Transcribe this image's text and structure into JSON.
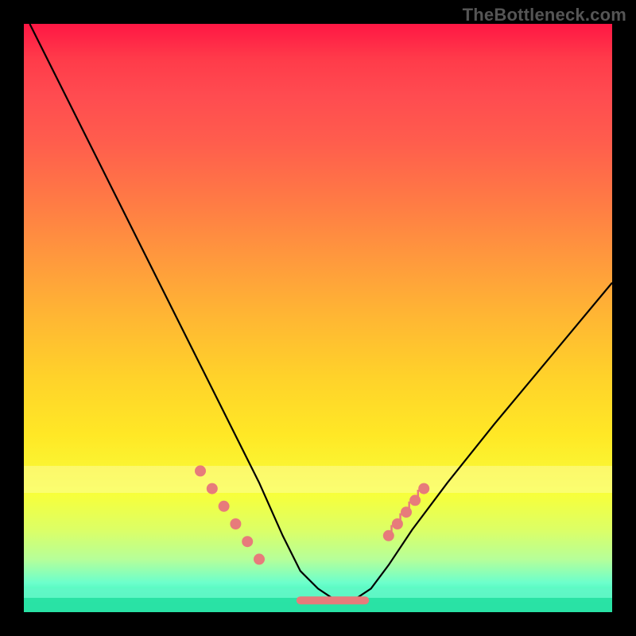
{
  "watermark": "TheBottleneck.com",
  "chart_data": {
    "type": "line",
    "title": "",
    "xlabel": "",
    "ylabel": "",
    "xlim": [
      0,
      100
    ],
    "ylim": [
      0,
      100
    ],
    "grid": false,
    "legend": false,
    "series": [
      {
        "name": "bottleneck-curve",
        "x": [
          1,
          5,
          10,
          15,
          20,
          25,
          30,
          35,
          40,
          44,
          47,
          50,
          53,
          56,
          59,
          62,
          66,
          72,
          80,
          90,
          100
        ],
        "y": [
          100,
          92,
          82,
          72,
          62,
          52,
          42,
          32,
          22,
          13,
          7,
          4,
          2,
          2,
          4,
          8,
          14,
          22,
          32,
          44,
          56
        ]
      }
    ],
    "markers": {
      "left_cluster_x": [
        30,
        32,
        34,
        36,
        38,
        40
      ],
      "left_cluster_y": [
        24,
        21,
        18,
        15,
        12,
        9
      ],
      "flat_segment": {
        "x_start": 47,
        "x_end": 58,
        "y": 2
      },
      "right_cluster_x": [
        62,
        63.5,
        65,
        66.5,
        68
      ],
      "right_cluster_y": [
        13,
        15,
        17,
        19,
        21
      ],
      "right_ticks_x": [
        62.5,
        64,
        65.5,
        67
      ],
      "right_ticks_y": [
        14,
        16,
        18,
        20
      ]
    },
    "annotations": []
  },
  "colors": {
    "gradient_top": "#ff1744",
    "gradient_bottom": "#25e0a5",
    "curve": "#000000",
    "markers": "#e77b7b",
    "watermark": "#555555",
    "frame": "#000000"
  }
}
